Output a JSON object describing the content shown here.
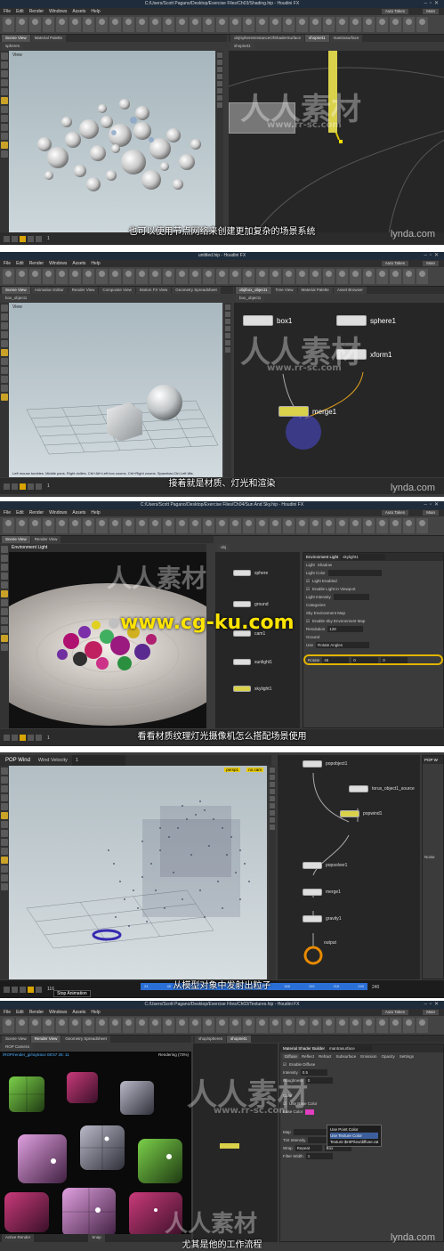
{
  "panels": [
    {
      "title": "C:/Users/Scott Pagano/Desktop/Exercise Files/Ch03/Shading.hip - Houdini FX",
      "menu": [
        "File",
        "Edit",
        "Render",
        "Windows",
        "Assets",
        "Help"
      ],
      "desktop": "Main",
      "desktop_right": "Auto Takes",
      "tabs_left": [
        "Scene View",
        "Material Palette"
      ],
      "tabs_right": [
        "obj/spheresInstanceOfShaderSurface",
        "shopnet1",
        "mantrasurface"
      ],
      "viewport_label": "View",
      "path_left": "spheres",
      "path_right": "shopnet1",
      "subtitle": "也可以使用节点网络来创建更加复杂的场景系统",
      "watermark": "人人素材",
      "watermark_url": "www.rr-sc.com",
      "brand": "lynda.com",
      "frame": "1",
      "colors": {
        "accent": "#d7a400",
        "titlebar": "#1e2c3c"
      }
    },
    {
      "title": "untitled.hip - Houdini FX",
      "menu": [
        "File",
        "Edit",
        "Render",
        "Windows",
        "Assets",
        "Help"
      ],
      "desktop": "Main",
      "desktop_right": "Auto Takes",
      "tabs_left": [
        "Scene View",
        "Animation Editor",
        "Render View",
        "Composite View",
        "Motion FX View",
        "Geometry Spreadsheet"
      ],
      "tabs_right": [
        "obj/box_object1",
        "Tree View",
        "Material Palette",
        "Asset Browser"
      ],
      "viewport_label": "View",
      "path_left": "box_object1",
      "path_right": "box_object1",
      "nodes": [
        "box1",
        "sphere1",
        "xform1",
        "merge1"
      ],
      "status": "Left mouse tumbles. Middle pans. Right dollies. Ctrl+Alt+Left box zooms. Ctrl+Right zooms. Spacebar-Ctrl-Left tilts.",
      "subtitle": "接着就是材质、灯光和渲染",
      "watermark": "人人素材",
      "watermark_url": "www.rr-sc.com",
      "brand": "lynda.com",
      "frame": "1"
    },
    {
      "title": "C:/Users/Scott Pagano/Desktop/Exercise Files/Ch04/Sun And Sky.hip - Houdini FX",
      "menu": [
        "File",
        "Edit",
        "Render",
        "Windows",
        "Assets",
        "Help"
      ],
      "desktop": "Main",
      "desktop_right": "Auto Takes",
      "tabs_left": [
        "Scene View",
        "Render View"
      ],
      "viewport_label": "Environment Light",
      "path_right": "obj",
      "nodes": [
        "sphere",
        "ground",
        "cam1",
        "sunlight1",
        "skylight1"
      ],
      "param_title": "Environment Light",
      "param_name": "skylight1",
      "param_tabs": [
        "Light",
        "Shadow"
      ],
      "param_rows": [
        "Light Color",
        "Light Enabled",
        "Enable Light in Viewport",
        "Light Intensity",
        "Categories",
        "Sky Environment Map",
        "Enable Sky Environment Map",
        "Resolution",
        "Ground",
        "Use",
        "Rotate"
      ],
      "sky_res": "128",
      "rotate_values": [
        "45",
        "0",
        "0"
      ],
      "rotate_mode": "Rotate Angles",
      "watermark": "www.cg-ku.com",
      "watermark2": "人人素材",
      "subtitle": "看看材质纹理灯光摄像机怎么搭配场景使用",
      "frame": "1"
    },
    {
      "viewport_label": "POP Wind",
      "param_label": "Wind Velocity",
      "param_value": "1",
      "cam_label": "persp1",
      "cam_label2": "no cam",
      "nodes": [
        "popobject1",
        "torus_object1_source",
        "popwind1",
        "popsolver1",
        "merge1",
        "gravity1",
        "output"
      ],
      "right_panel_title": "POP W",
      "right_panel_tab": "Noise",
      "subtitle": "从模型对象中发射出粒子",
      "stop_label": "Stop Animation",
      "frame": "116",
      "timeline_ticks": [
        "24",
        "48",
        "72",
        "96",
        "120",
        "144",
        "168",
        "192",
        "216",
        "240"
      ],
      "end_frame": "240"
    },
    {
      "title": "C:/Users/Scott Pagano/Desktop/Exercise Files/Ch03/Textures.hip - Houdini FX",
      "menu": [
        "File",
        "Edit",
        "Render",
        "Windows",
        "Assets",
        "Help"
      ],
      "desktop": "Main",
      "desktop_right": "Auto Takes",
      "tabs_left": [
        "Scene View",
        "Render View",
        "Geometry Spreadsheet"
      ],
      "tabs_right": [
        "shop/spheres",
        "shopnet1"
      ],
      "render_label": "ROP Camera",
      "render_status": "Rendering (73%)",
      "render_path": "/ROP/render_gi/raytrace 08:57 26: 11",
      "param_title": "Material Shader Builder",
      "param_name": "mantrasurface",
      "param_tabs": [
        "Diffuse",
        "Reflect",
        "Refract",
        "Subsurface",
        "Emission",
        "Opacity",
        "Settings"
      ],
      "param_rows": [
        "Enable Diffuse",
        "Intensity",
        "Roughness",
        "Color",
        "Use Base Color",
        "Base Color",
        "Map",
        "Tint Intensity",
        "Wrap",
        "Filter Width"
      ],
      "intensity": "0.5",
      "roughness": "0",
      "tooltip": [
        "Use Point Color",
        "Use Texture Color",
        "Texture $HIP/tex/diffuse.rat"
      ],
      "wrap_value": "Repeat",
      "filter_value": "Box",
      "filter_width": "1",
      "snap_label": "Snap",
      "render_tab": "Active Render",
      "subtitle": "尤其是他的工作流程",
      "watermark": "人人素材",
      "watermark_url": "www.rr-sc.com",
      "brand": "lynda.com"
    }
  ]
}
